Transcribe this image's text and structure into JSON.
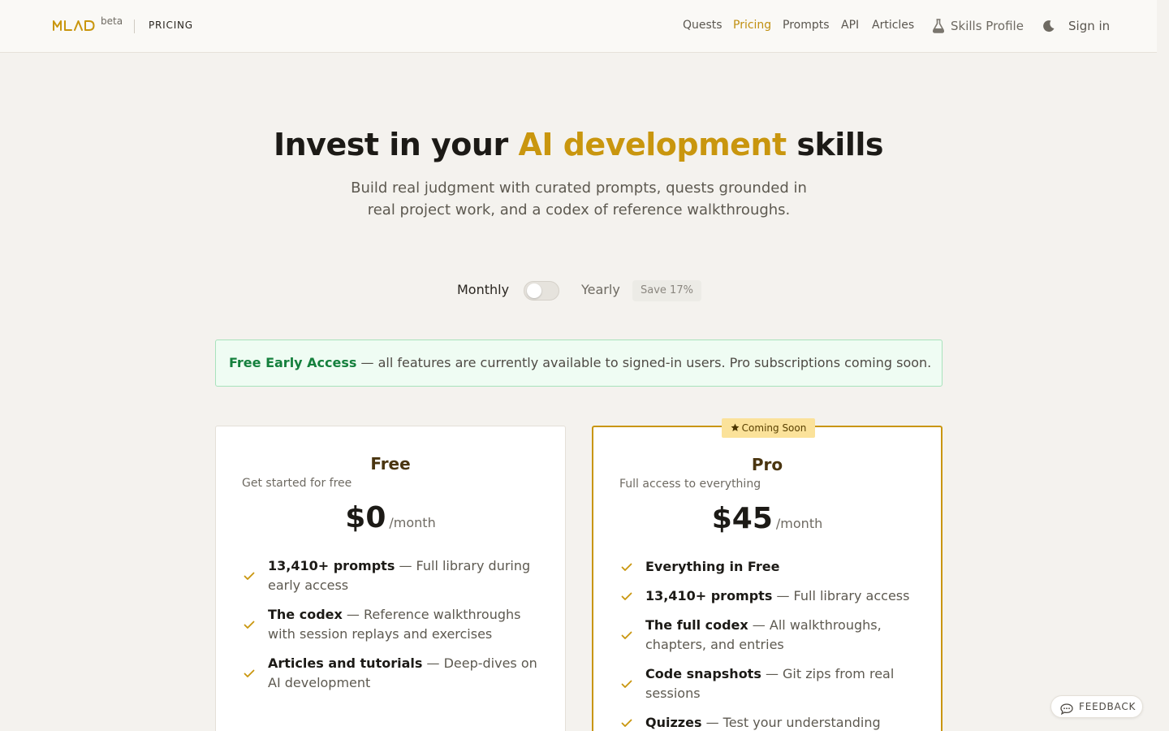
{
  "header": {
    "logo_alt": "MLAD",
    "beta": "beta",
    "section": "PRICING",
    "nav": [
      {
        "label": "Quests",
        "active": false
      },
      {
        "label": "Pricing",
        "active": true
      },
      {
        "label": "Prompts",
        "active": false
      },
      {
        "label": "API",
        "active": false
      },
      {
        "label": "Articles",
        "active": false
      }
    ],
    "skills_profile": "Skills Profile",
    "sign_in": "Sign in",
    "accent_color": "#c08f10"
  },
  "hero": {
    "title_pre": "Invest in your ",
    "title_accent": "AI development",
    "title_post": " skills",
    "subtitle": "Build real judgment with curated prompts, quests grounded in real project work, and a codex of reference walkthroughs."
  },
  "billing": {
    "monthly": "Monthly",
    "yearly": "Yearly",
    "save": "Save 17%",
    "yearly_selected": false
  },
  "notice": {
    "strong": "Free Early Access",
    "text": " — all features are currently available to signed-in users. Pro subscriptions coming soon."
  },
  "plans": {
    "free": {
      "name": "Free",
      "subtitle": "Get started for free",
      "price": "$0",
      "period": "/month",
      "features": [
        {
          "name": "13,410+ prompts",
          "desc": " — Full library during early access"
        },
        {
          "name": "The codex",
          "desc": " — Reference walkthroughs with session replays and exercises"
        },
        {
          "name": "Articles and tutorials",
          "desc": " — Deep-dives on AI development"
        }
      ]
    },
    "pro": {
      "badge": "Coming Soon",
      "name": "Pro",
      "subtitle": "Full access to everything",
      "price": "$45",
      "period": "/month",
      "features": [
        {
          "name": "Everything in Free",
          "desc": ""
        },
        {
          "name": "13,410+ prompts",
          "desc": " — Full library access"
        },
        {
          "name": "The full codex",
          "desc": " — All walkthroughs, chapters, and entries"
        },
        {
          "name": "Code snapshots",
          "desc": " — Git zips from real sessions"
        },
        {
          "name": "Quizzes",
          "desc": " — Test your understanding"
        }
      ]
    }
  },
  "feedback": {
    "label": "FEEDBACK"
  },
  "icons": {
    "skills": "flask-icon",
    "theme": "moon-icon",
    "check": "check-icon",
    "star": "star-icon",
    "feedback": "chat-bubble-icon"
  },
  "colors": {
    "gold": "#c9960e",
    "green": "#15803d",
    "notice_bg": "#effcf3",
    "badge_bg": "#fbe29a"
  }
}
